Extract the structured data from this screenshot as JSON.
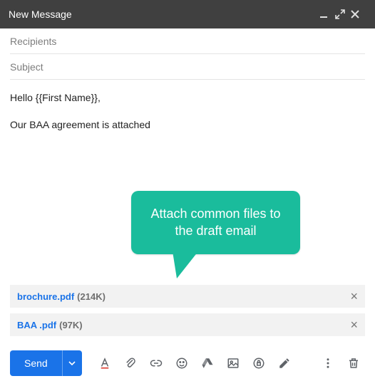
{
  "window": {
    "title": "New Message"
  },
  "fields": {
    "recipients_placeholder": "Recipients",
    "subject_placeholder": "Subject"
  },
  "body": {
    "line1": "Hello {{First Name}},",
    "line2": "Our BAA agreement is attached"
  },
  "callout": {
    "text": "Attach common files to the draft email"
  },
  "attachments": [
    {
      "name": "brochure.pdf",
      "size": "(214K)"
    },
    {
      "name": "BAA .pdf",
      "size": "(97K)"
    }
  ],
  "toolbar": {
    "send_label": "Send"
  },
  "colors": {
    "accent": "#1a73e8",
    "callout": "#1abc9c"
  }
}
